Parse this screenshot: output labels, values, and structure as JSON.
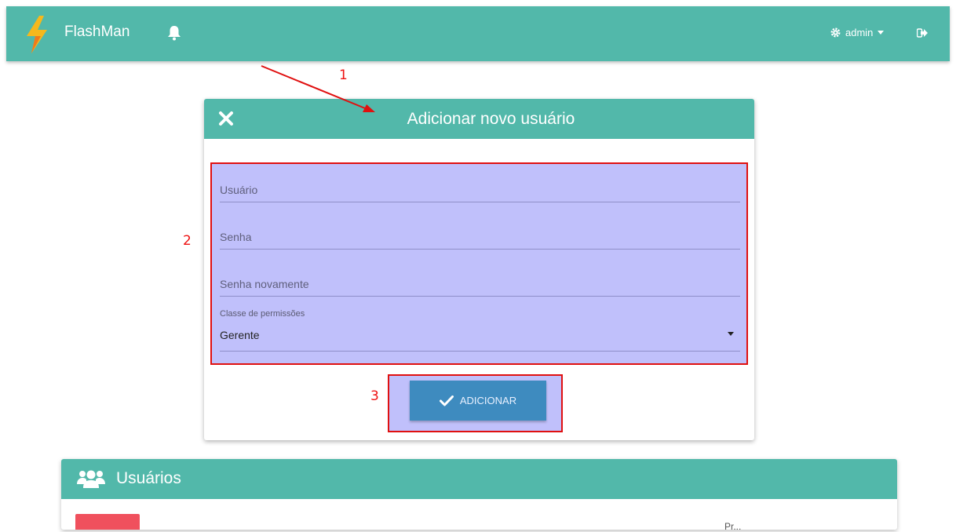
{
  "navbar": {
    "brand": "FlashMan",
    "user_label": "admin",
    "icons": [
      "lightning-logo",
      "bell-icon",
      "gear-icon",
      "caret-down-icon",
      "logout-icon"
    ],
    "color": "#52b8aa"
  },
  "annotations": {
    "one": "1",
    "two": "2",
    "three": "3",
    "color": "#e11111"
  },
  "modal": {
    "title": "Adicionar novo usuário",
    "fields": {
      "usuario_placeholder": "Usuário",
      "senha_placeholder": "Senha",
      "senha2_placeholder": "Senha novamente"
    },
    "select_label": "Classe de permissões",
    "select_value": "Gerente",
    "submit_label": "ADICIONAR",
    "highlight_color": "#c0c0fb"
  },
  "users_card": {
    "title": "Usuários",
    "partial_text": "Pr..."
  }
}
